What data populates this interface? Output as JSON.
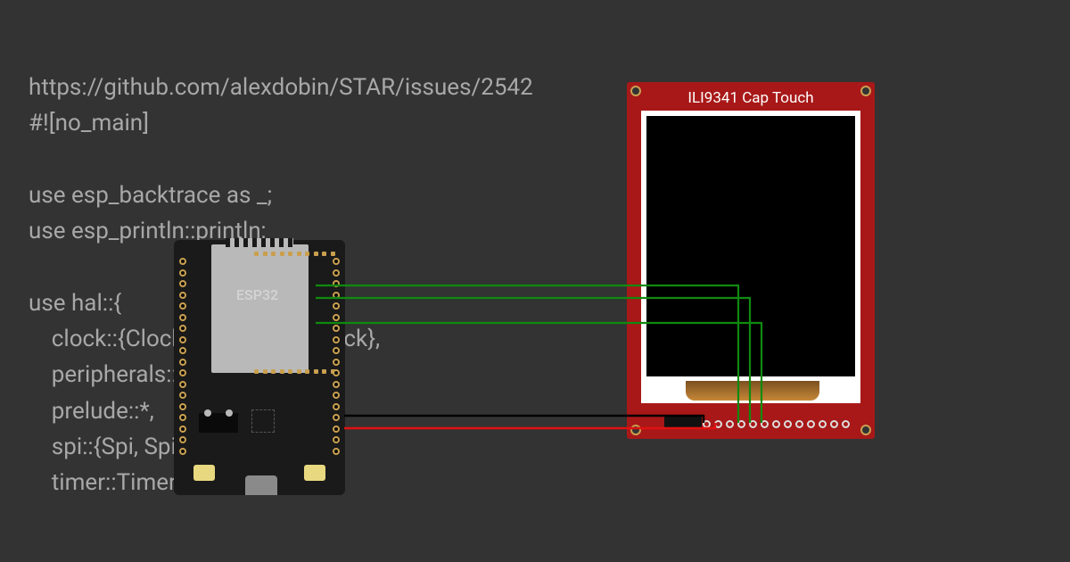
{
  "code": {
    "line1": "https://github.com/alexdobin/STAR/issues/2542",
    "line2": "#![no_main]",
    "line3": "",
    "line4": "use esp_backtrace as _;",
    "line5": "use esp_println::println;",
    "line6": "",
    "line7": "use hal::{",
    "line8": "    clock::{ClockControl, CpuClock},",
    "line9": "    peripherals::Peripherals,",
    "line10": "    prelude::*,",
    "line11": "    spi::{Spi, SpiMode},",
    "line12": "    timer::TimerGroup,"
  },
  "components": {
    "esp32": {
      "label": "ESP32"
    },
    "display": {
      "title": "ILI9341 Cap Touch"
    }
  },
  "wires": [
    {
      "color": "#0f7a0f",
      "from": "esp32-pin",
      "to": "display-pin"
    },
    {
      "color": "#0f7a0f",
      "from": "esp32-pin",
      "to": "display-pin"
    },
    {
      "color": "#0f7a0f",
      "from": "esp32-pin",
      "to": "display-pin"
    },
    {
      "color": "#000000",
      "from": "esp32-gnd",
      "to": "display-gnd"
    },
    {
      "color": "#d20000",
      "from": "esp32-3v3",
      "to": "display-vcc"
    }
  ]
}
